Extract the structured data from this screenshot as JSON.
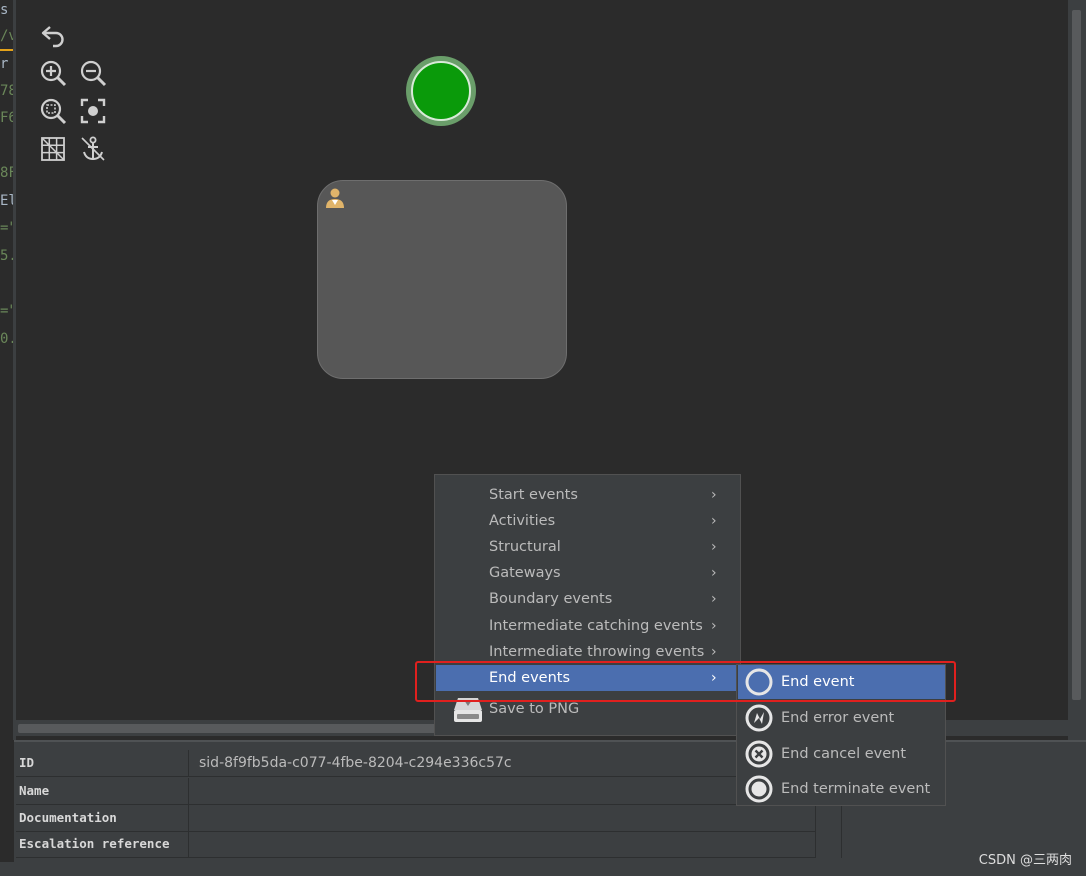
{
  "code_gutter": {
    "fragments": [
      "s :",
      "/v",
      "r",
      "78",
      "F6",
      "8F",
      "El",
      "=\"",
      "5.",
      "=\"",
      "0."
    ]
  },
  "toolbar": {
    "undo": "undo-icon",
    "zoom_in": "zoom-in-icon",
    "zoom_out": "zoom-out-icon",
    "zoom_actual": "zoom-actual-icon",
    "zoom_fit": "zoom-fit-icon",
    "grid": "grid-icon",
    "anchor": "anchor-icon"
  },
  "diagram": {
    "start_event_color": "#0a9a0a",
    "task_color": "#575757",
    "user_icon_color": "#e0b46a"
  },
  "context_menu": {
    "items": [
      {
        "label": "Start events",
        "submenu": true
      },
      {
        "label": "Activities",
        "submenu": true
      },
      {
        "label": "Structural",
        "submenu": true
      },
      {
        "label": "Gateways",
        "submenu": true
      },
      {
        "label": "Boundary events",
        "submenu": true
      },
      {
        "label": "Intermediate catching events",
        "submenu": true
      },
      {
        "label": "Intermediate throwing events",
        "submenu": true
      },
      {
        "label": "End events",
        "submenu": true,
        "active": true
      },
      {
        "label": "Save to PNG",
        "submenu": false
      }
    ],
    "arrow_glyph": "›"
  },
  "submenu": {
    "items": [
      {
        "label": "End event",
        "icon": "end-event-icon",
        "active": true
      },
      {
        "label": "End error event",
        "icon": "end-error-event-icon"
      },
      {
        "label": "End cancel event",
        "icon": "end-cancel-event-icon"
      },
      {
        "label": "End terminate event",
        "icon": "end-terminate-event-icon"
      }
    ]
  },
  "properties": {
    "rows": [
      {
        "key": "ID",
        "value": "sid-8f9fb5da-c077-4fbe-8204-c294e336c57c"
      },
      {
        "key": "Name",
        "value": ""
      },
      {
        "key": "Documentation",
        "value": ""
      },
      {
        "key": "Escalation reference",
        "value": ""
      }
    ]
  },
  "watermark": "CSDN @三两肉",
  "colors": {
    "menu_active": "#4b6eaf",
    "highlight_border": "#e0201e"
  }
}
